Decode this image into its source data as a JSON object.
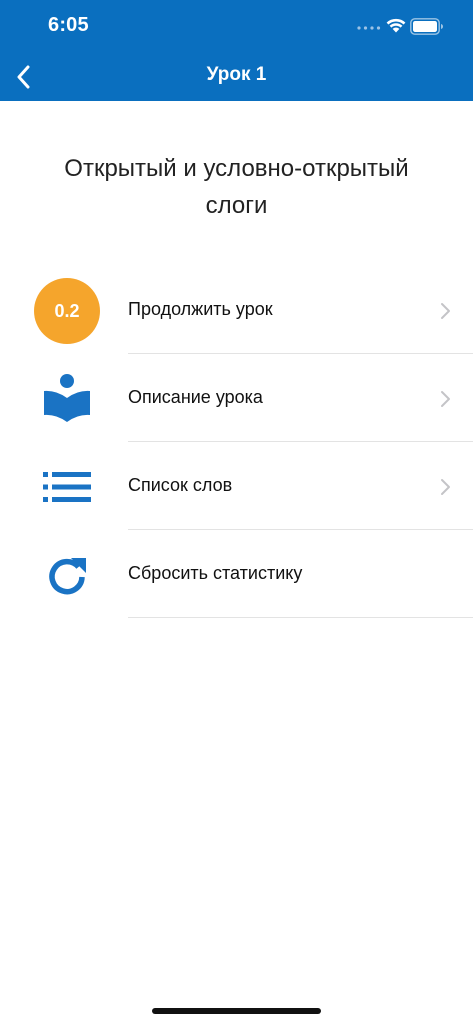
{
  "status_bar": {
    "time": "6:05",
    "icons": [
      "signal-dots-icon",
      "wifi-icon",
      "battery-icon"
    ]
  },
  "nav": {
    "title": "Урок 1",
    "back_icon": "chevron-left-icon"
  },
  "lesson": {
    "title_line1": "Открытый и условно-открытый",
    "title_line2": "слоги"
  },
  "menu": {
    "items": [
      {
        "label": "Продолжить урок",
        "icon": "progress-badge",
        "badge": "0.2",
        "has_chevron": true
      },
      {
        "label": "Описание урока",
        "icon": "reading-book-icon",
        "has_chevron": true
      },
      {
        "label": "Список слов",
        "icon": "list-icon",
        "has_chevron": true
      },
      {
        "label": "Сбросить статистику",
        "icon": "refresh-icon",
        "has_chevron": false
      }
    ]
  },
  "colors": {
    "header": "#0a6fbf",
    "accent_blue": "#1a73c4",
    "badge_orange": "#f5a52c",
    "chevron": "#c4c4c7",
    "divider": "#e3e3e3"
  }
}
